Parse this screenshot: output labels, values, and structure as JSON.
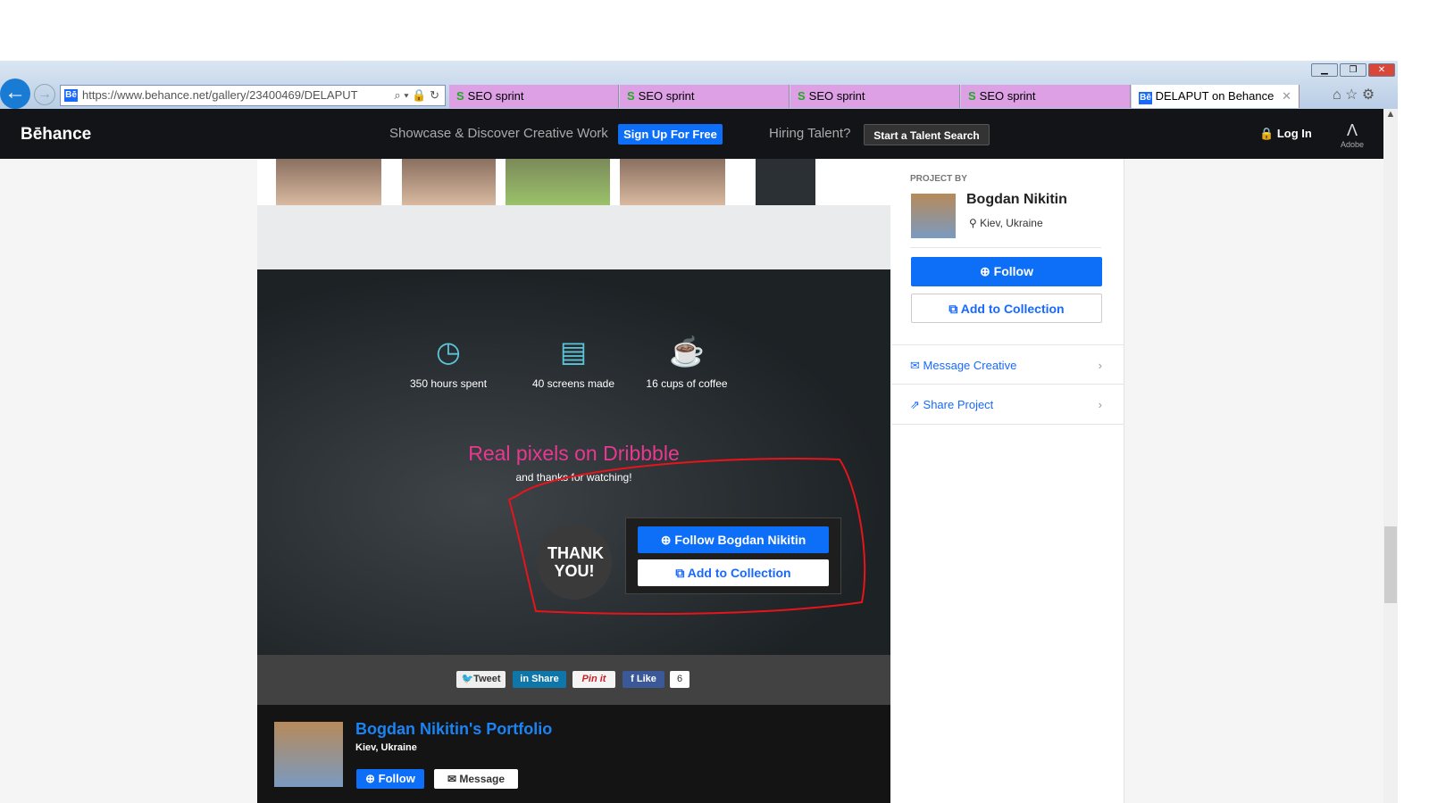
{
  "browser": {
    "url": "https://www.behance.net/gallery/23400469/DELAPUT",
    "tabs": [
      "SEO sprint",
      "SEO sprint",
      "SEO sprint",
      "SEO sprint"
    ],
    "active_tab": "DELAPUT on Behance",
    "favicon": "Bē"
  },
  "nav": {
    "logo": "Bēhance",
    "tagline": "Showcase & Discover Creative Work",
    "signup": "Sign Up For Free",
    "hiring": "Hiring Talent?",
    "talent_search": "Start a Talent Search",
    "login": "Log In",
    "adobe": "Adobe"
  },
  "stats": [
    {
      "icon": "clock-icon",
      "label": "350 hours spent"
    },
    {
      "icon": "document-icon",
      "label": "40 screens made"
    },
    {
      "icon": "cup-icon",
      "label": "16 cups of coffee"
    }
  ],
  "project": {
    "headline": "Real pixels on Dribbble",
    "thanks": "and thanks for watching!",
    "badge": "THANK YOU!",
    "follow": "Follow Bogdan Nikitin",
    "add": "Add to Collection"
  },
  "social": {
    "tweet": "Tweet",
    "share": "Share",
    "pin": "Pin it",
    "like": "Like",
    "like_count": "6"
  },
  "portfolio": {
    "title": "Bogdan Nikitin's Portfolio",
    "location": "Kiev, Ukraine",
    "follow": "Follow",
    "message": "Message"
  },
  "sidebar": {
    "project_by": "PROJECT BY",
    "name": "Bogdan Nikitin",
    "location": "Kiev, Ukraine",
    "follow": "Follow",
    "add": "Add to Collection",
    "message": "Message Creative",
    "share": "Share Project"
  },
  "colors": {
    "accent": "#1769ff",
    "headline": "#e8388f",
    "annotation": "#e8141c"
  }
}
